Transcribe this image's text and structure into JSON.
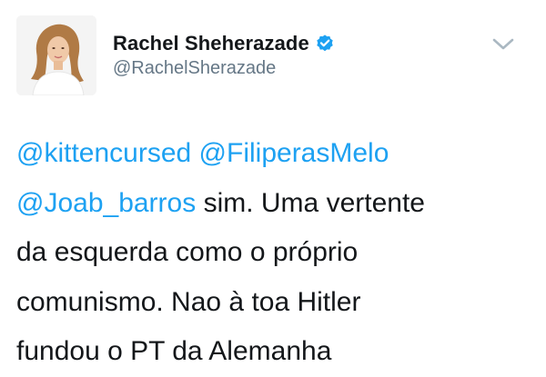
{
  "author": {
    "display_name": "Rachel Sheherazade",
    "handle": "@RachelSherazade",
    "verified_icon": "verified-badge-icon",
    "avatar_icon": "profile-photo"
  },
  "menu": {
    "icon": "chevron-down-icon"
  },
  "tweet": {
    "line1": {
      "mention1": "@kittencursed",
      "mention2": "@FiliperasMelo"
    },
    "line2": {
      "mention": "@Joab_barros",
      "text": " sim. Uma vertente"
    },
    "line3": "da esquerda como o próprio",
    "line4": "comunismo. Nao à toa Hitler",
    "line5": "fundou o PT da Alemanha"
  },
  "colors": {
    "link": "#1da1f2",
    "text": "#14171a",
    "secondary": "#657786",
    "verified": "#1da1f2"
  }
}
